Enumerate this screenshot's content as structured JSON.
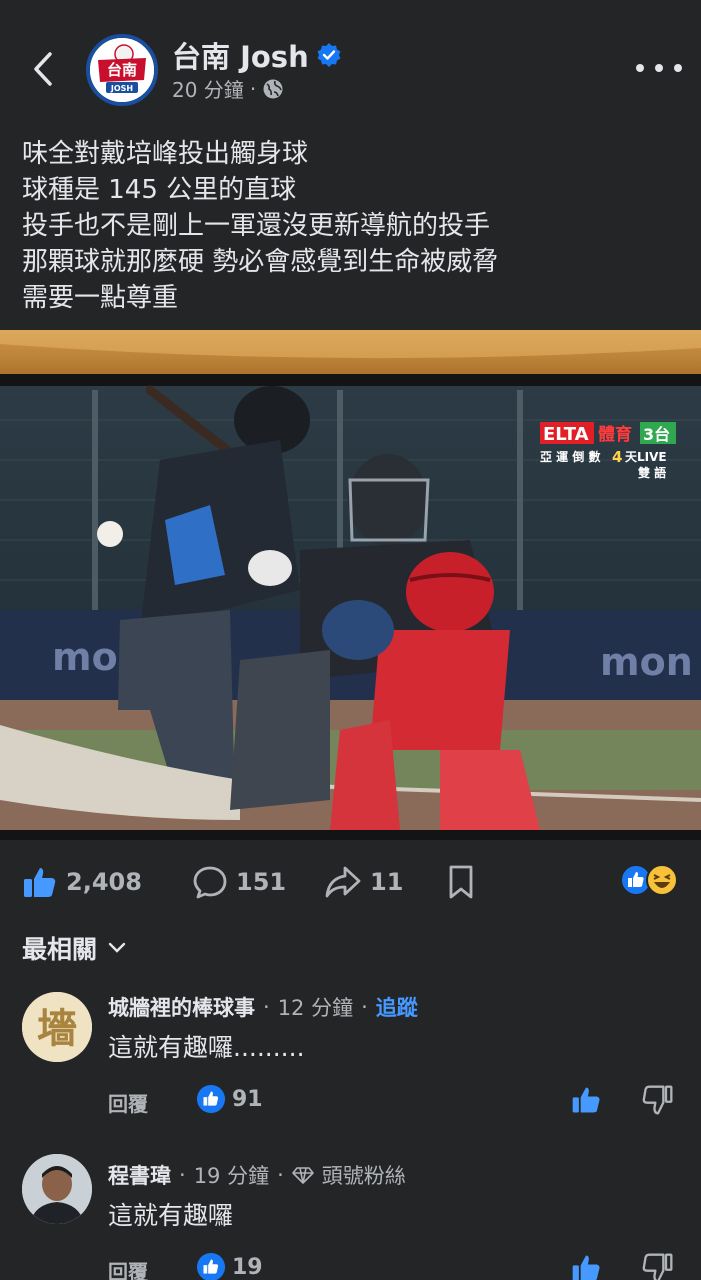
{
  "post": {
    "page_name": "台南 Josh",
    "time": "20 分鐘",
    "meta_separator": "·",
    "icons": {
      "back": "chevron-left-icon",
      "verified": "verified-badge-icon",
      "audience": "globe-icon",
      "more": "more-horizontal-icon"
    },
    "avatar_logo": {
      "line1": "台南",
      "line2": "JOSH"
    },
    "text_lines": [
      "味全對戴培峰投出觸身球",
      "球種是 145 公里的直球",
      "投手也不是剛上一軍還沒更新導航的投手",
      "那顆球就那麼硬 勢必會感覺到生命被威脅",
      "需要一點尊重"
    ]
  },
  "photo": {
    "broadcast_logo": "ELTA",
    "broadcast_sub": "體育",
    "channel": "3台",
    "overlay_line1": "亞 運 倒 數",
    "overlay_days": "4",
    "overlay_line1b": "天LIVE",
    "overlay_line2": "雙 語",
    "sponsor_left": "mo",
    "sponsor_right": "mon"
  },
  "stats": {
    "likes": "2,408",
    "comments": "151",
    "shares": "11",
    "icons": [
      "like-icon",
      "comment-icon",
      "share-icon",
      "bookmark-icon",
      "like-reaction-icon",
      "haha-reaction-icon"
    ]
  },
  "sort": {
    "label": "最相關",
    "icon": "chevron-down-icon"
  },
  "comments": [
    {
      "author": "城牆裡的棒球事",
      "time": "12 分鐘",
      "extra": "追蹤",
      "text": "這就有趣囉.........",
      "reply_label": "回覆",
      "likes": "91",
      "avatar_glyph": "墻"
    },
    {
      "author": "程書瑋",
      "time": "19 分鐘",
      "extra": "頭號粉絲",
      "text": "這就有趣囉",
      "reply_label": "回覆",
      "likes": "19"
    }
  ],
  "colors": {
    "background": "#242526",
    "accent_blue": "#4599ff",
    "like_blue": "#1877f2",
    "secondary_text": "#b0b3b8"
  }
}
